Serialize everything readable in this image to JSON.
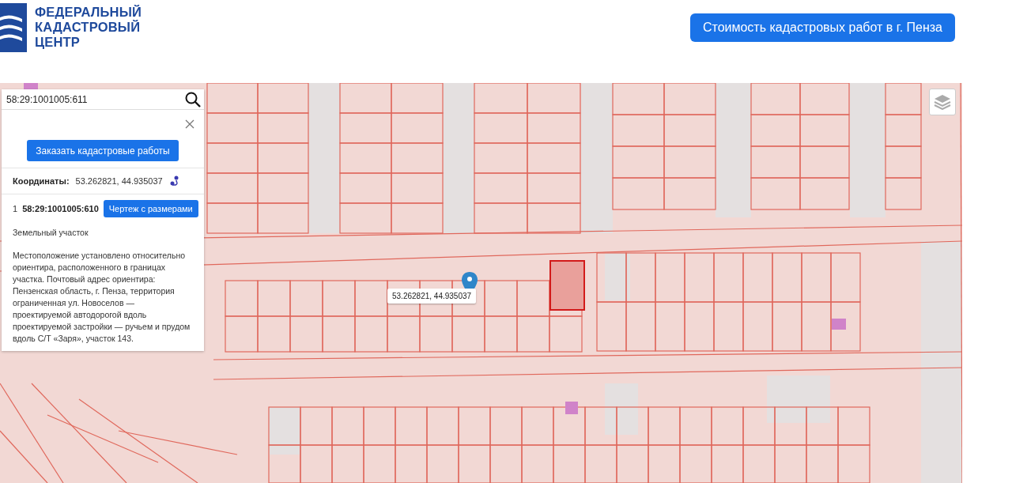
{
  "header": {
    "logo_lines": [
      "ФЕДЕРАЛЬНЫЙ",
      "КАДАСТРОВЫЙ",
      "ЦЕНТР"
    ],
    "cost_button": "Стоимость кадастровых работ в г. Пенза"
  },
  "search": {
    "value": "58:29:1001005:611"
  },
  "info_panel": {
    "order_button": "Заказать кадастровые работы",
    "coordinates_label": "Координаты:",
    "coordinates_value": "53.262821, 44.935037",
    "parcel": {
      "index": "1",
      "number": "58:29:1001005:610",
      "drawing_button": "Чертеж с размерами"
    },
    "type": "Земельный участок",
    "address": "Местоположение установлено относительно ориентира, расположенного в границах участка. Почтовый адрес ориентира: Пензенская область, г. Пенза, территория ограниченная ул. Новоселов — проектируемой автодорогой вдоль проектируемой застройки — ручьем и прудом вдоль С/Т «Заря», участок 143."
  },
  "map": {
    "marker_popup": "53.262821, 44.935037"
  }
}
